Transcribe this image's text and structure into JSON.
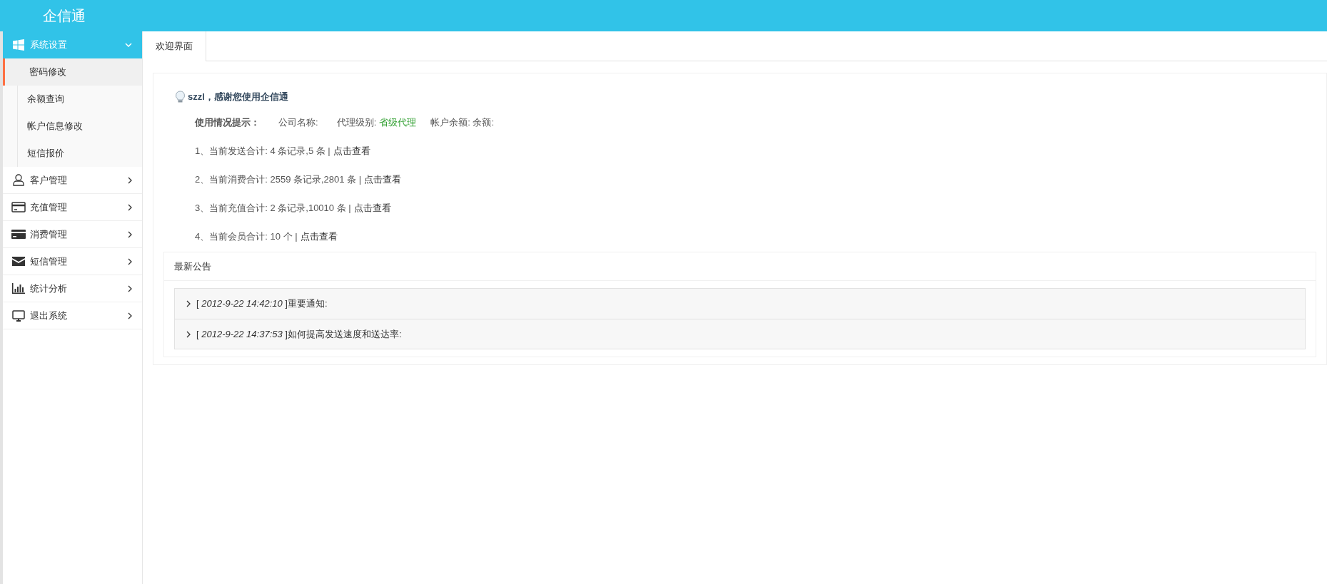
{
  "header": {
    "title": "企信通"
  },
  "sidebar": {
    "items": [
      {
        "label": "系统设置",
        "expanded": true,
        "children": [
          {
            "label": "密码修改",
            "selected": true
          },
          {
            "label": "余额查询",
            "selected": false
          },
          {
            "label": "帐户信息修改",
            "selected": false
          },
          {
            "label": "短信报价",
            "selected": false
          }
        ]
      },
      {
        "label": "客户管理",
        "expanded": false
      },
      {
        "label": "充值管理",
        "expanded": false
      },
      {
        "label": "消费管理",
        "expanded": false
      },
      {
        "label": "短信管理",
        "expanded": false
      },
      {
        "label": "统计分析",
        "expanded": false
      },
      {
        "label": "退出系统",
        "expanded": false
      }
    ]
  },
  "tabs": [
    {
      "label": "欢迎界面",
      "selected": true
    }
  ],
  "welcome": {
    "greeting": "szzl，感谢您使用企信通",
    "usage": {
      "title": "使用情况提示：",
      "company_label": "公司名称:",
      "agent_label": "代理级别:",
      "agent_value": "省级代理",
      "balance_label": "帐户余额: 余额:"
    },
    "stats": [
      {
        "text": "1、当前发送合计: 4 条记录,5 条 |",
        "link": "点击查看"
      },
      {
        "text": "2、当前消费合计: 2559 条记录,2801 条 |",
        "link": "点击查看"
      },
      {
        "text": "3、当前充值合计: 2 条记录,10010 条 |",
        "link": "点击查看"
      },
      {
        "text": "4、当前会员合计: 10 个 |",
        "link": "点击查看"
      }
    ]
  },
  "notices": {
    "title": "最新公告",
    "items": [
      {
        "text": "[ *2012-9-22 14:42:10* ]重要通知:",
        "expanded": false
      },
      {
        "text": "[ *2012-9-22 14:37:53* ]如何提高发送速度和送达率:",
        "expanded": false
      }
    ]
  }
}
